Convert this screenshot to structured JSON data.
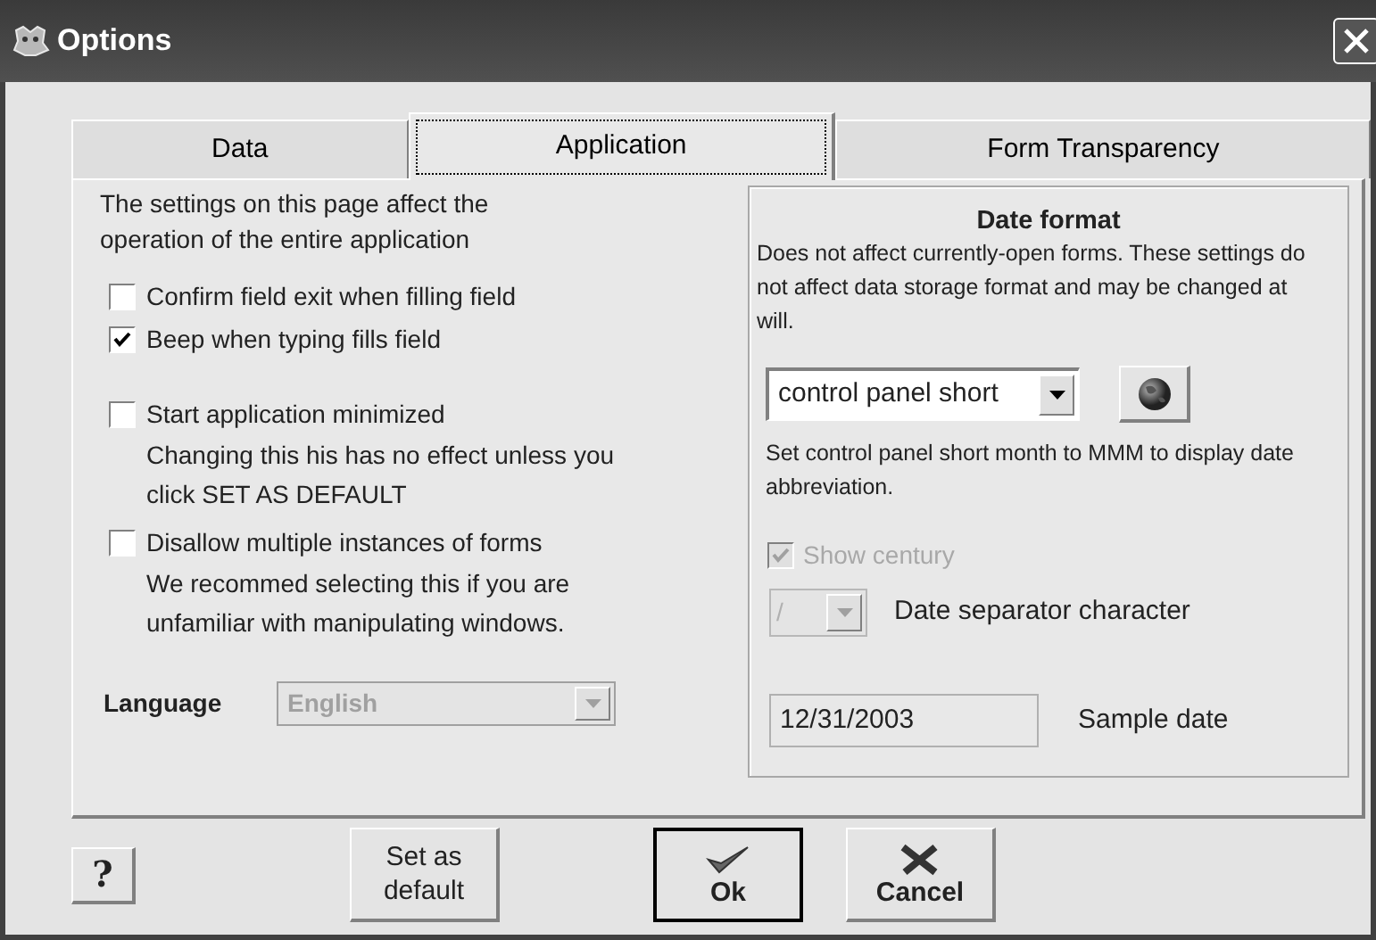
{
  "window": {
    "title": "Options"
  },
  "tabs": [
    {
      "label": "Data",
      "selected": false
    },
    {
      "label": "Application",
      "selected": true
    },
    {
      "label": "Form Transparency",
      "selected": false
    }
  ],
  "application": {
    "intro": "The settings on this page affect the operation of the entire application",
    "options": [
      {
        "label": "Confirm field exit when filling field",
        "checked": false
      },
      {
        "label": "Beep when typing fills field",
        "checked": true
      },
      {
        "label": "Start application minimized",
        "checked": false,
        "note": "Changing this his has no effect unless you click SET AS DEFAULT"
      },
      {
        "label": "Disallow multiple instances of forms",
        "checked": false,
        "note": "We recommed selecting this if you are unfamiliar with manipulating windows."
      }
    ],
    "language": {
      "label": "Language",
      "value": "English",
      "disabled": true
    }
  },
  "date_format": {
    "title": "Date format",
    "description": "Does not affect currently-open forms.  These settings do not affect data storage format and may be changed at will.",
    "format_select": {
      "value": "control panel short"
    },
    "note": "Set control panel short month to MMM to display date abbreviation.",
    "show_century": {
      "label": "Show century",
      "checked": true,
      "disabled": true
    },
    "separator": {
      "value": "/",
      "label": "Date separator character",
      "disabled": true
    },
    "sample": {
      "value": "12/31/2003",
      "label": "Sample date"
    }
  },
  "buttons": [
    {
      "kind": "help",
      "label": "?",
      "default": false
    },
    {
      "kind": "text",
      "label": "Set as default",
      "default": false
    },
    {
      "kind": "ok",
      "label": "Ok",
      "default": true
    },
    {
      "kind": "cancel",
      "label": "Cancel",
      "default": false
    }
  ]
}
